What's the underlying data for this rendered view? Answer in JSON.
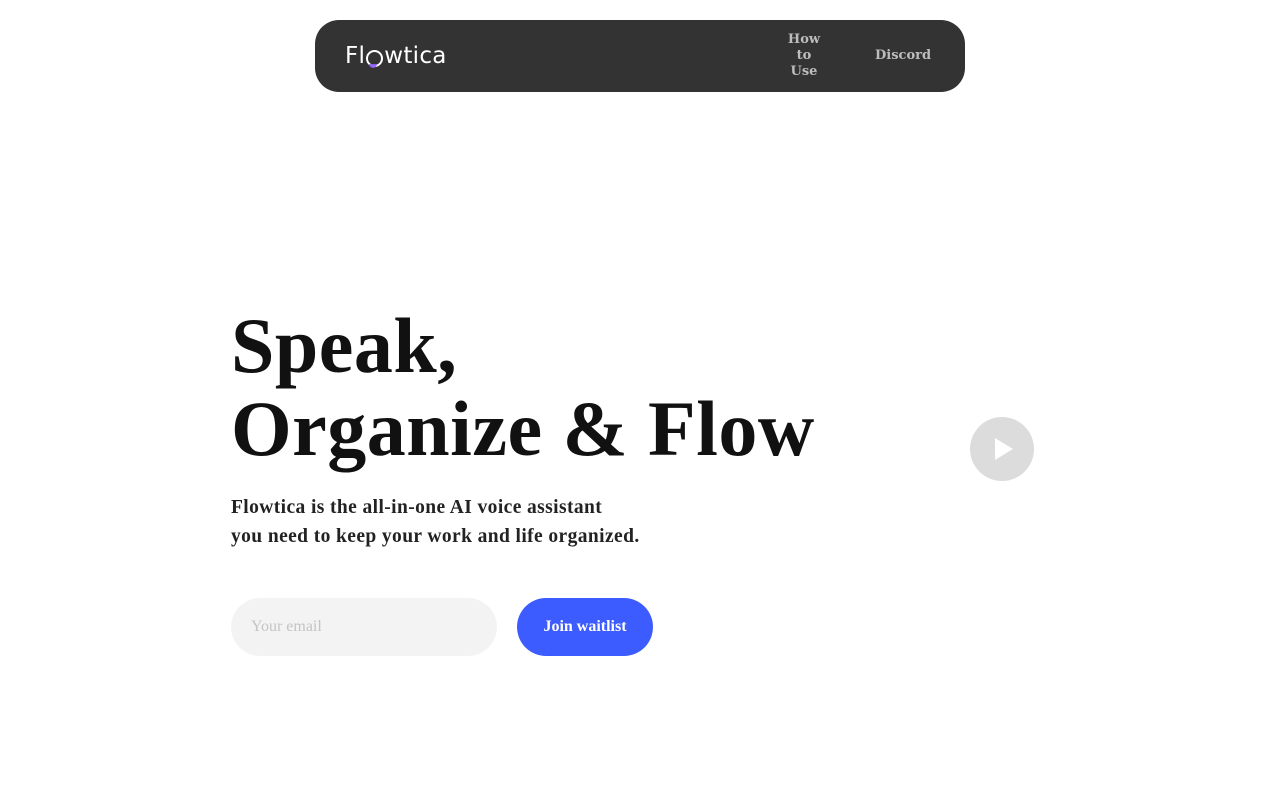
{
  "nav": {
    "logo_prefix": "Fl",
    "logo_suffix": "wtica",
    "links": [
      {
        "label": "How to Use"
      },
      {
        "label": "Discord"
      }
    ]
  },
  "hero": {
    "title_line1": "Speak,",
    "title_line2": "Organize & Flow",
    "subtitle_line1": "Flowtica is the all-in-one AI voice assistant",
    "subtitle_line2": "you need to keep your work and life organized."
  },
  "signup": {
    "email_placeholder": "Your email",
    "button_label": "Join waitlist"
  },
  "colors": {
    "nav_background": "#333333",
    "accent": "#3d5cff",
    "play_button": "#dcdcdc"
  }
}
